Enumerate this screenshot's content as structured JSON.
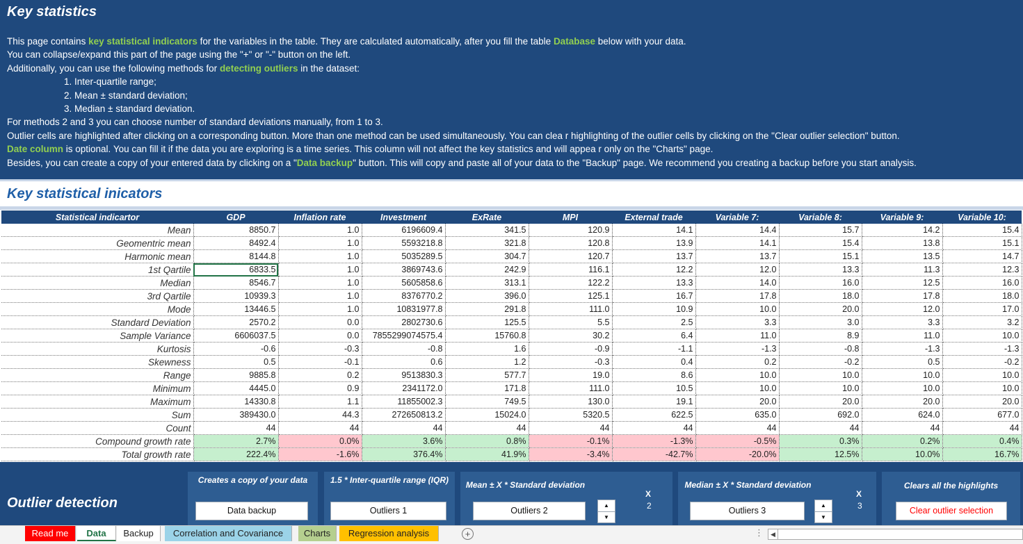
{
  "header": {
    "title": "Key statistics",
    "line1": [
      "This page contains ",
      "key statistical indicators",
      " for the variables in the table. They are calculated automatically, after you fill the table ",
      "Database",
      " below with your data."
    ],
    "line2": "You can collapse/expand this part of the page using the \"+\" or  \"-\" button on the left.",
    "line3": [
      "Additionally, you can use the following methods for ",
      "detecting outliers",
      " in the dataset:"
    ],
    "methods": [
      "1. Inter-quartile range;",
      "2. Mean ± standard deviation;",
      "3. Median ± standard deviation."
    ],
    "line4": "For methods 2 and 3 you can choose number of standard deviations manually, from 1 to 3.",
    "line5": "Outlier cells are highlighted after clicking on a corresponding button. More than one method can be used simultaneously. You can clea r highlighting of the outlier cells by clicking on the \"Clear outlier selection\" button.",
    "line6": [
      "Date column",
      " is optional. You can fill it if the data you are exploring is a time series. This column will not affect the key statistics and will appea r only on the \"Charts\" page."
    ],
    "line7": [
      "Besides, you can create a copy of your entered data by clicking on a \"",
      "Data backup",
      "\" button. This will copy and paste all of your data to the \"Backup\" page. We recommend you creating a backup before you start  analysis."
    ]
  },
  "section_title": "Key statistical inicators",
  "table": {
    "headers": [
      "Statistical indicartor",
      "GDP",
      "Inflation rate",
      "Investment",
      "ExRate",
      "MPI",
      "External trade",
      "Variable 7:",
      "Variable 8:",
      "Variable 9:",
      "Variable 10:"
    ],
    "rows": [
      {
        "label": "Mean",
        "values": [
          "8850.7",
          "1.0",
          "6196609.4",
          "341.5",
          "120.9",
          "14.1",
          "14.4",
          "15.7",
          "14.2",
          "15.4"
        ]
      },
      {
        "label": "Geomentric mean",
        "values": [
          "8492.4",
          "1.0",
          "5593218.8",
          "321.8",
          "120.8",
          "13.9",
          "14.1",
          "15.4",
          "13.8",
          "15.1"
        ]
      },
      {
        "label": "Harmonic mean",
        "values": [
          "8144.8",
          "1.0",
          "5035289.5",
          "304.7",
          "120.7",
          "13.7",
          "13.7",
          "15.1",
          "13.5",
          "14.7"
        ]
      },
      {
        "label": "1st Qartile",
        "values": [
          "6833.5",
          "1.0",
          "3869743.6",
          "242.9",
          "116.1",
          "12.2",
          "12.0",
          "13.3",
          "11.3",
          "12.3"
        ]
      },
      {
        "label": "Median",
        "values": [
          "8546.7",
          "1.0",
          "5605858.6",
          "313.1",
          "122.2",
          "13.3",
          "14.0",
          "16.0",
          "12.5",
          "16.0"
        ]
      },
      {
        "label": "3rd Qartile",
        "values": [
          "10939.3",
          "1.0",
          "8376770.2",
          "396.0",
          "125.1",
          "16.7",
          "17.8",
          "18.0",
          "17.8",
          "18.0"
        ]
      },
      {
        "label": "Mode",
        "values": [
          "13446.5",
          "1.0",
          "10831977.8",
          "291.8",
          "111.0",
          "10.9",
          "10.0",
          "20.0",
          "12.0",
          "17.0"
        ]
      },
      {
        "label": "Standard Deviation",
        "values": [
          "2570.2",
          "0.0",
          "2802730.6",
          "125.5",
          "5.5",
          "2.5",
          "3.3",
          "3.0",
          "3.3",
          "3.2"
        ]
      },
      {
        "label": "Sample Variance",
        "values": [
          "6606037.5",
          "0.0",
          "7855299074575.4",
          "15760.8",
          "30.2",
          "6.4",
          "11.0",
          "8.9",
          "11.0",
          "10.0"
        ]
      },
      {
        "label": "Kurtosis",
        "values": [
          "-0.6",
          "-0.3",
          "-0.8",
          "1.6",
          "-0.9",
          "-1.1",
          "-1.3",
          "-0.8",
          "-1.3",
          "-1.3"
        ]
      },
      {
        "label": "Skewness",
        "values": [
          "0.5",
          "-0.1",
          "0.6",
          "1.2",
          "-0.3",
          "0.4",
          "0.2",
          "-0.2",
          "0.5",
          "-0.2"
        ]
      },
      {
        "label": "Range",
        "values": [
          "9885.8",
          "0.2",
          "9513830.3",
          "577.7",
          "19.0",
          "8.6",
          "10.0",
          "10.0",
          "10.0",
          "10.0"
        ]
      },
      {
        "label": "Minimum",
        "values": [
          "4445.0",
          "0.9",
          "2341172.0",
          "171.8",
          "111.0",
          "10.5",
          "10.0",
          "10.0",
          "10.0",
          "10.0"
        ]
      },
      {
        "label": "Maximum",
        "values": [
          "14330.8",
          "1.1",
          "11855002.3",
          "749.5",
          "130.0",
          "19.1",
          "20.0",
          "20.0",
          "20.0",
          "20.0"
        ]
      },
      {
        "label": "Sum",
        "values": [
          "389430.0",
          "44.3",
          "272650813.2",
          "15024.0",
          "5320.5",
          "622.5",
          "635.0",
          "692.0",
          "624.0",
          "677.0"
        ]
      },
      {
        "label": "Count",
        "values": [
          "44",
          "44",
          "44",
          "44",
          "44",
          "44",
          "44",
          "44",
          "44",
          "44"
        ]
      },
      {
        "label": "Compound growth rate",
        "values": [
          "2.7%",
          "0.0%",
          "3.6%",
          "0.8%",
          "-0.1%",
          "-1.3%",
          "-0.5%",
          "0.3%",
          "0.2%",
          "0.4%"
        ]
      },
      {
        "label": "Total growth rate",
        "values": [
          "222.4%",
          "-1.6%",
          "376.4%",
          "41.9%",
          "-3.4%",
          "-42.7%",
          "-20.0%",
          "12.5%",
          "10.0%",
          "16.7%"
        ]
      }
    ],
    "growth_colors": {
      "Compound growth rate": [
        "g",
        "r",
        "g",
        "g",
        "r",
        "r",
        "r",
        "g",
        "g",
        "g"
      ],
      "Total growth rate": [
        "g",
        "r",
        "g",
        "g",
        "r",
        "r",
        "r",
        "g",
        "g",
        "g"
      ]
    }
  },
  "outlier": {
    "title": "Outlier detection",
    "panel_backup": {
      "text": "Creates a copy of your data",
      "button": "Data backup"
    },
    "panel_iqr": {
      "text": "1.5 * Inter-quartile range (IQR)",
      "button": "Outliers 1"
    },
    "panel_mean": {
      "text": "Mean ± X * Standard deviation",
      "x_label": "X",
      "x_value": "2",
      "button": "Outliers 2"
    },
    "panel_median": {
      "text": "Median ± X * Standard deviation",
      "x_label": "X",
      "x_value": "3",
      "button": "Outliers 3"
    },
    "panel_clear": {
      "text": "Clears all the highlights",
      "button": "Clear outlier selection"
    }
  },
  "tabs": [
    {
      "label": "Read me",
      "color": "#ff0000"
    },
    {
      "label": "Data",
      "color": "#ffffff",
      "active": true
    },
    {
      "label": "Backup",
      "color": "#ffffff"
    },
    {
      "label": "Correlation and Covariance",
      "color": "#9bd3e8"
    },
    {
      "label": "Charts",
      "color": "#b5cf8f"
    },
    {
      "label": "Regression analysis",
      "color": "#ffc000"
    }
  ],
  "colors": {
    "header_bg": "#1f497d",
    "accent_green": "#92d050",
    "positive_fill": "#c6efce",
    "negative_fill": "#ffc7ce",
    "clear_red": "#ff0000"
  }
}
